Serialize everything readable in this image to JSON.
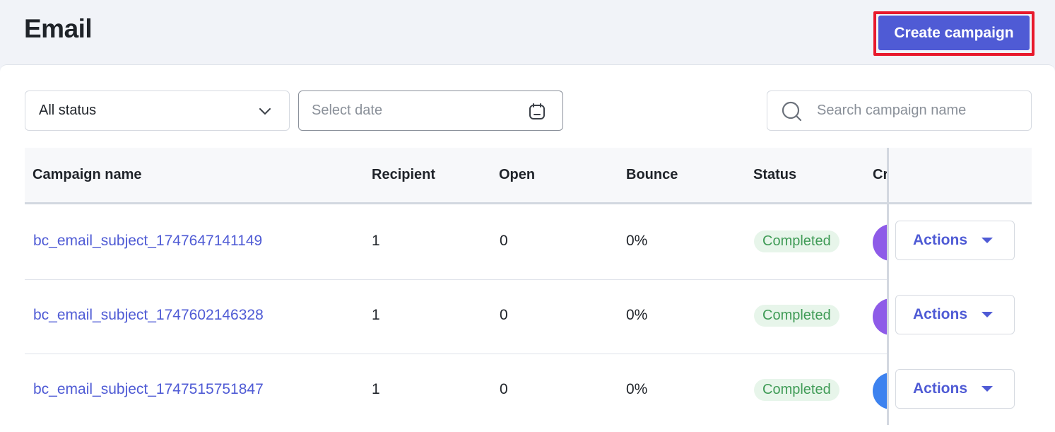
{
  "header": {
    "title": "Email",
    "create_button_label": "Create campaign"
  },
  "filters": {
    "status_select_value": "All status",
    "date_placeholder": "Select date",
    "search_placeholder": "Search campaign name"
  },
  "table": {
    "columns": [
      "Campaign name",
      "Recipient",
      "Open",
      "Bounce",
      "Status",
      "Cr"
    ],
    "rows": [
      {
        "name": "bc_email_subject_1747647141149",
        "recipient": "1",
        "open": "0",
        "bounce": "0%",
        "status": "Completed",
        "avatar_color": "#8e5be8",
        "actions_label": "Actions"
      },
      {
        "name": "bc_email_subject_1747602146328",
        "recipient": "1",
        "open": "0",
        "bounce": "0%",
        "status": "Completed",
        "avatar_color": "#8e5be8",
        "actions_label": "Actions"
      },
      {
        "name": "bc_email_subject_1747515751847",
        "recipient": "1",
        "open": "0",
        "bounce": "0%",
        "status": "Completed",
        "avatar_color": "#3d82ef",
        "actions_label": "Actions"
      }
    ]
  },
  "colors": {
    "accent": "#4f5bd5",
    "highlight_border": "#e8192c",
    "status_completed_bg": "#e7f5ea",
    "status_completed_text": "#3f9b56"
  }
}
